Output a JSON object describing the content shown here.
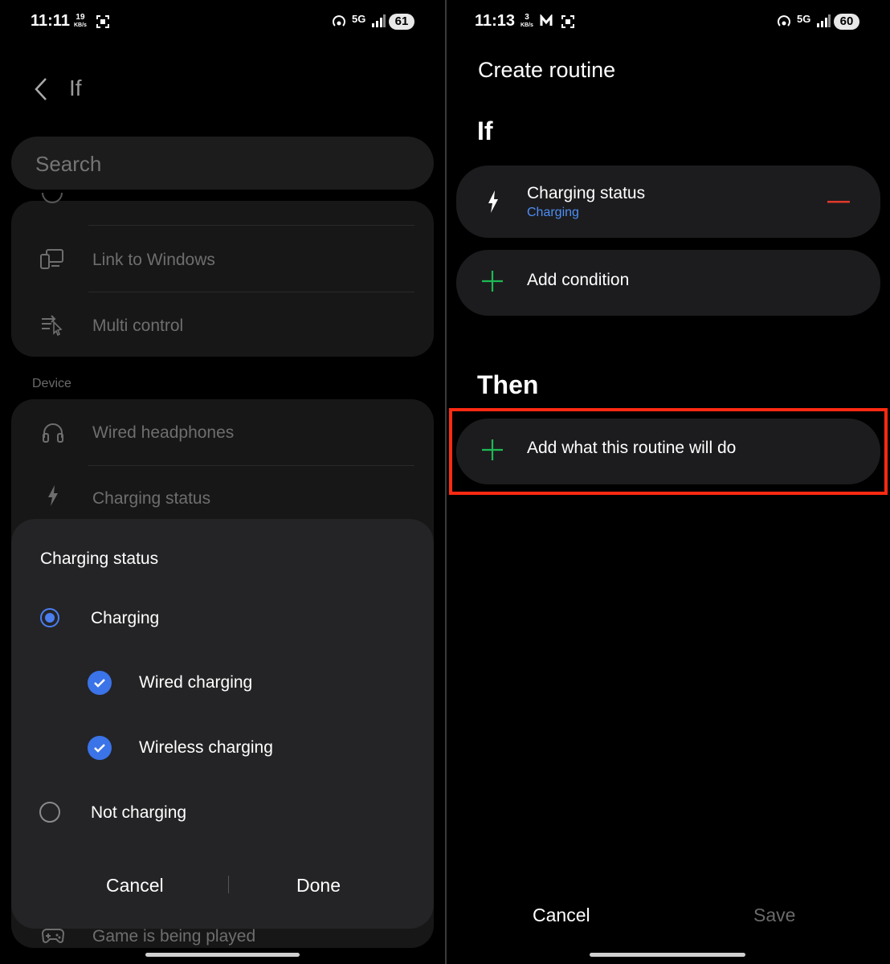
{
  "left": {
    "status": {
      "time": "11:11",
      "netspeed_value": "19",
      "netspeed_unit": "KB/s",
      "battery": "61",
      "network": "5G"
    },
    "header": {
      "title": "If"
    },
    "search": {
      "placeholder": "Search"
    },
    "group1": {
      "items": [
        {
          "label": "Link to Windows"
        },
        {
          "label": "Multi control"
        }
      ]
    },
    "section_label": "Device",
    "group2": {
      "items": [
        {
          "label": "Wired headphones"
        },
        {
          "label": "Charging status"
        }
      ]
    },
    "bottom_item": {
      "label": "Game is being played"
    },
    "dialog": {
      "title": "Charging status",
      "options": [
        {
          "label": "Charging",
          "selected": true
        },
        {
          "label": "Not charging",
          "selected": false
        }
      ],
      "sub_options": [
        {
          "label": "Wired charging",
          "checked": true
        },
        {
          "label": "Wireless charging",
          "checked": true
        }
      ],
      "cancel": "Cancel",
      "done": "Done",
      "accent_color": "#3b73e8"
    }
  },
  "right": {
    "status": {
      "time": "11:13",
      "netspeed_value": "3",
      "netspeed_unit": "KB/s",
      "battery": "60",
      "network": "5G"
    },
    "page_title": "Create routine",
    "if_heading": "If",
    "condition": {
      "title": "Charging status",
      "subtitle": "Charging"
    },
    "add_condition": "Add condition",
    "then_heading": "Then",
    "add_action": "Add what this routine will do",
    "footer": {
      "cancel": "Cancel",
      "save": "Save"
    },
    "colors": {
      "add_icon": "#1db954",
      "remove_icon": "#e0392b",
      "subtitle": "#4d8ef7",
      "highlight": "#ff2a12"
    }
  }
}
